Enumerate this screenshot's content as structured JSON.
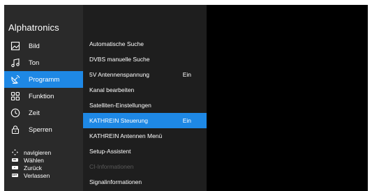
{
  "sidebar": {
    "brand": "Alphatronics",
    "items": [
      {
        "label": "Bild",
        "icon": "image-icon"
      },
      {
        "label": "Ton",
        "icon": "music-note-icon"
      },
      {
        "label": "Programm",
        "icon": "satellite-dish-icon",
        "active": true
      },
      {
        "label": "Funktion",
        "icon": "grid-icon"
      },
      {
        "label": "Zeit",
        "icon": "clock-icon"
      },
      {
        "label": "Sperren",
        "icon": "lock-icon"
      }
    ],
    "hints": [
      {
        "label": "navigieren",
        "icon": "dpad-icon"
      },
      {
        "label": "Wählen",
        "icon": "ok-key-icon",
        "key": "OK"
      },
      {
        "label": "Zurück",
        "icon": "back-key-icon",
        "key": "↩"
      },
      {
        "label": "Verlassen",
        "icon": "exit-key-icon",
        "key": "EXIT"
      }
    ]
  },
  "submenu": {
    "items": [
      {
        "label": "Automatische Suche",
        "value": ""
      },
      {
        "label": "DVBS manuelle Suche",
        "value": ""
      },
      {
        "label": "5V Antennenspannung",
        "value": "Ein"
      },
      {
        "label": "Kanal bearbeiten",
        "value": ""
      },
      {
        "label": "Satelliten-Einstellungen",
        "value": ""
      },
      {
        "label": "KATHREIN Steuerung",
        "value": "Ein",
        "active": true
      },
      {
        "label": "KATHREIN Antennen Menü",
        "value": ""
      },
      {
        "label": "Setup-Assistent",
        "value": ""
      },
      {
        "label": "CI-Informationen",
        "value": "",
        "disabled": true
      },
      {
        "label": "Signalinformationen",
        "value": ""
      }
    ]
  },
  "colors": {
    "accent": "#1e88e5",
    "sidebar_bg": "#2a2a2a",
    "submenu_bg": "#1e1e1e",
    "disabled_text": "#5a5a5a"
  }
}
